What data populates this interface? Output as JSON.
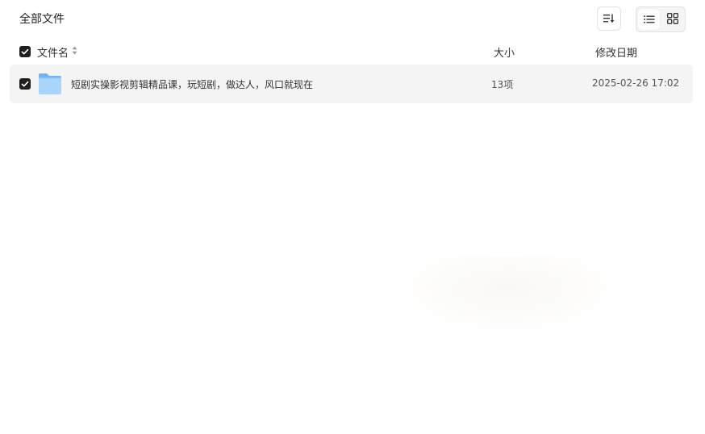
{
  "breadcrumb": {
    "title": "全部文件"
  },
  "toolbar": {
    "sort_icon": "sort-lines-icon",
    "view_list_icon": "list-view-icon",
    "view_grid_icon": "grid-view-icon",
    "active_view": "list"
  },
  "table": {
    "columns": {
      "name": "文件名",
      "size": "大小",
      "date": "修改日期"
    },
    "rows": [
      {
        "icon": "folder-icon",
        "name": "短剧实操影视剪辑精品课，玩短剧，做达人，风口就现在",
        "size": "13项",
        "date": "2025-02-26 17:02",
        "checked": true
      }
    ]
  },
  "colors": {
    "row_bg": "#f4f4f4",
    "checkbox": "#1f1f1f",
    "folder_light": "#a9d4fb",
    "folder_dark": "#6fb3f4"
  }
}
